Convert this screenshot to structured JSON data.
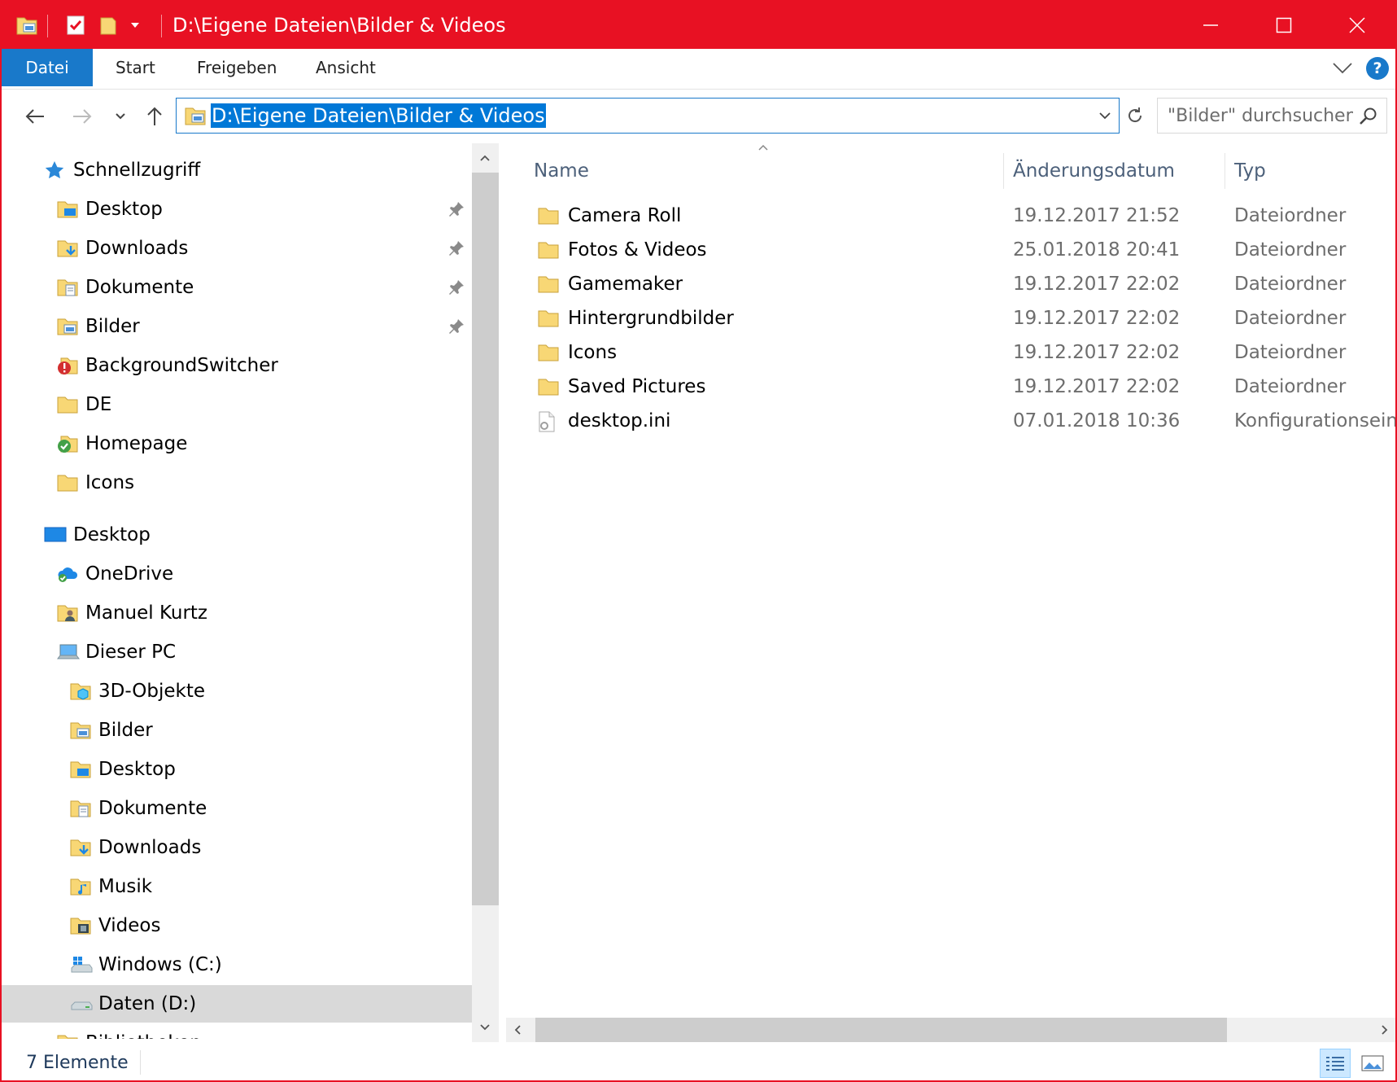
{
  "window": {
    "title": "D:\\Eigene Dateien\\Bilder & Videos",
    "accent_color": "#e81123",
    "buttons": [
      "minimize-icon",
      "maximize-icon",
      "close-icon"
    ]
  },
  "quick_access_toolbar": [
    "folder-picture-icon",
    "properties-check-icon",
    "new-folder-icon",
    "customize-dropdown-icon"
  ],
  "ribbon": {
    "tabs": [
      {
        "label": "Datei",
        "active": true
      },
      {
        "label": "Start"
      },
      {
        "label": "Freigeben"
      },
      {
        "label": "Ansicht"
      }
    ],
    "help_label": "?"
  },
  "navigation": {
    "address_path": "D:\\Eigene Dateien\\Bilder & Videos",
    "search_placeholder": "\"Bilder\" durchsuchen"
  },
  "nav_pane": {
    "items": [
      {
        "label": "Schnellzugriff",
        "icon": "star-icon",
        "level": 0
      },
      {
        "label": "Desktop",
        "icon": "desktop-folder-icon",
        "level": 1,
        "pinned": true
      },
      {
        "label": "Downloads",
        "icon": "downloads-folder-icon",
        "level": 1,
        "pinned": true
      },
      {
        "label": "Dokumente",
        "icon": "documents-folder-icon",
        "level": 1,
        "pinned": true
      },
      {
        "label": "Bilder",
        "icon": "pictures-folder-icon",
        "level": 1,
        "pinned": true
      },
      {
        "label": "BackgroundSwitcher",
        "icon": "error-badge-folder-icon",
        "level": 1
      },
      {
        "label": "DE",
        "icon": "folder-icon",
        "level": 1
      },
      {
        "label": "Homepage",
        "icon": "check-badge-folder-icon",
        "level": 1
      },
      {
        "label": "Icons",
        "icon": "folder-icon",
        "level": 1
      },
      {
        "label": "Desktop",
        "icon": "desktop-icon",
        "level": 0,
        "gap": true
      },
      {
        "label": "OneDrive",
        "icon": "onedrive-icon",
        "level": 1
      },
      {
        "label": "Manuel Kurtz",
        "icon": "user-folder-icon",
        "level": 1
      },
      {
        "label": "Dieser PC",
        "icon": "pc-icon",
        "level": 1
      },
      {
        "label": "3D-Objekte",
        "icon": "3d-objects-folder-icon",
        "level": 2
      },
      {
        "label": "Bilder",
        "icon": "pictures-folder-icon",
        "level": 2
      },
      {
        "label": "Desktop",
        "icon": "desktop-folder-icon",
        "level": 2
      },
      {
        "label": "Dokumente",
        "icon": "documents-folder-icon",
        "level": 2
      },
      {
        "label": "Downloads",
        "icon": "downloads-folder-icon",
        "level": 2
      },
      {
        "label": "Musik",
        "icon": "music-folder-icon",
        "level": 2
      },
      {
        "label": "Videos",
        "icon": "videos-folder-icon",
        "level": 2
      },
      {
        "label": "Windows (C:)",
        "icon": "windows-drive-icon",
        "level": 2
      },
      {
        "label": "Daten (D:)",
        "icon": "drive-icon",
        "level": 2,
        "selected": true
      },
      {
        "label": "Bibliotheken",
        "icon": "library-folder-icon",
        "level": 1,
        "partial": true
      }
    ]
  },
  "content": {
    "columns": {
      "name": "Name",
      "date": "Änderungsdatum",
      "type": "Typ"
    },
    "rows": [
      {
        "name": "Camera Roll",
        "date": "19.12.2017 21:52",
        "type": "Dateiordner",
        "icon": "folder-icon"
      },
      {
        "name": "Fotos & Videos",
        "date": "25.01.2018 20:41",
        "type": "Dateiordner",
        "icon": "folder-icon"
      },
      {
        "name": "Gamemaker",
        "date": "19.12.2017 22:02",
        "type": "Dateiordner",
        "icon": "folder-icon"
      },
      {
        "name": "Hintergrundbilder",
        "date": "19.12.2017 22:02",
        "type": "Dateiordner",
        "icon": "folder-icon"
      },
      {
        "name": "Icons",
        "date": "19.12.2017 22:02",
        "type": "Dateiordner",
        "icon": "folder-icon"
      },
      {
        "name": "Saved Pictures",
        "date": "19.12.2017 22:02",
        "type": "Dateiordner",
        "icon": "folder-icon"
      },
      {
        "name": "desktop.ini",
        "date": "07.01.2018 10:36",
        "type": "Konfigurationseinstellungen",
        "icon": "ini-file-icon"
      }
    ]
  },
  "status": {
    "item_count": "7 Elemente",
    "views": [
      "details-view-icon",
      "large-icons-view-icon"
    ]
  },
  "colors": {
    "title_bar": "#e81123",
    "file_tab": "#1979ca",
    "selection": "#0078d7",
    "folder_yellow": "#f8d775",
    "header_text": "#4c607a"
  }
}
